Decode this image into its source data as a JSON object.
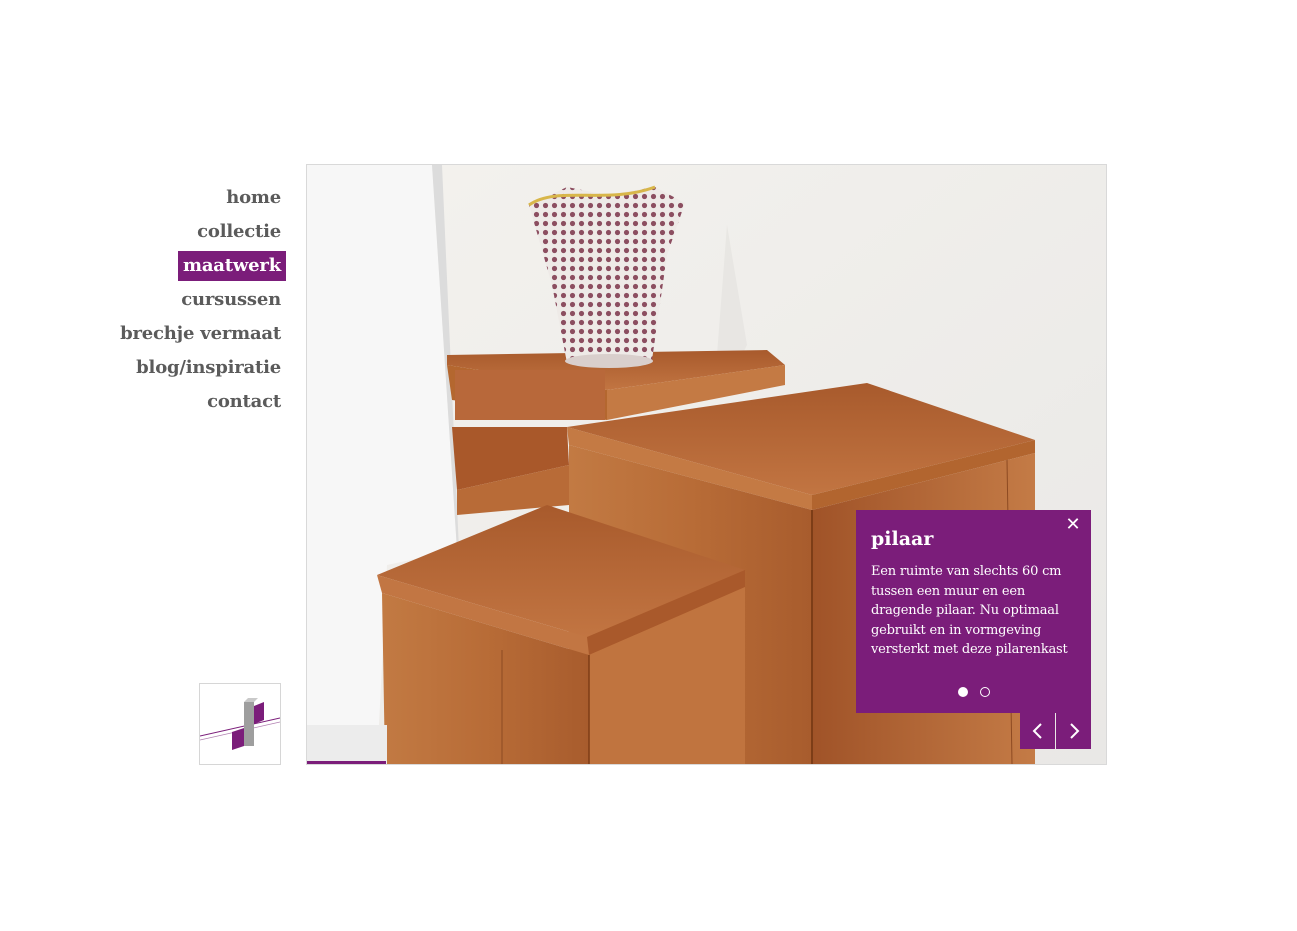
{
  "nav": {
    "items": [
      {
        "label": "home"
      },
      {
        "label": "collectie"
      },
      {
        "label": "maatwerk"
      },
      {
        "label": "cursussen"
      },
      {
        "label": "brechje vermaat"
      },
      {
        "label": "blog/inspiratie"
      },
      {
        "label": "contact"
      }
    ],
    "active_index": 2
  },
  "slide": {
    "image_alt": "houten pilarenkast met vaas",
    "caption": {
      "title": "pilaar",
      "text": "Een ruimte van slechts 60 cm tussen een muur en een dragende pilaar. Nu optimaal gebruikt en in vormgeving versterkt met deze pilarenkast"
    },
    "slide_count": 2,
    "current_slide": 1,
    "close_icon": "close-icon",
    "prev_icon": "chevron-left-icon",
    "next_icon": "chevron-right-icon"
  },
  "colors": {
    "accent": "#7b1d7a",
    "nav_text": "#5b5b5b",
    "wood": "#b5693a"
  }
}
